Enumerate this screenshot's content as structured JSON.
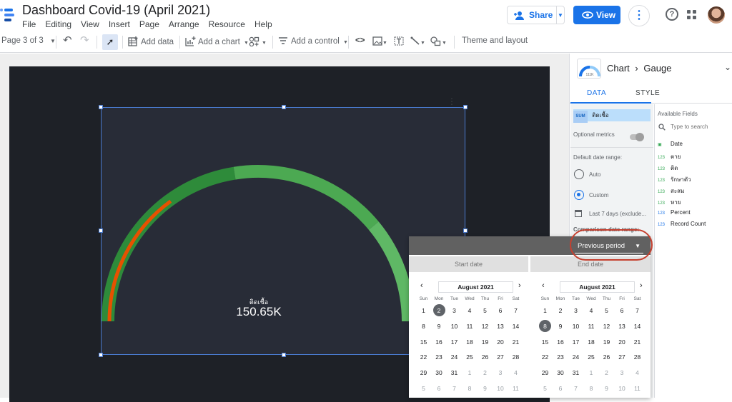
{
  "app": {
    "title": "Dashboard Covid-19 (April 2021)",
    "menu": [
      "File",
      "Editing",
      "View",
      "Insert",
      "Page",
      "Arrange",
      "Resource",
      "Help"
    ],
    "share_label": "Share",
    "view_label": "View",
    "brand_color": "#1a73e8"
  },
  "toolbar": {
    "page_indicator": "Page 3 of 3",
    "add_data": "Add data",
    "add_chart": "Add a chart",
    "add_control": "Add a control",
    "theme_layout": "Theme and layout",
    "code_glyph": "<>"
  },
  "gauge": {
    "metric_label": "ติดเชื้อ",
    "value": "150.65K",
    "fill_fraction": 0.3,
    "track_color": "#4caf50",
    "progress_color": "#e65100"
  },
  "panel": {
    "crumb_parent": "Chart",
    "crumb_child": "Gauge",
    "thumb_value": "111K",
    "tabs": [
      "DATA",
      "STYLE"
    ],
    "metric_agg": "SUM",
    "metric_name": "ติดเชื้อ",
    "optional_metrics": "Optional metrics",
    "default_date_range": "Default date range:",
    "range_auto": "Auto",
    "range_custom": "Custom",
    "range_value": "Last 7 days (exclude...",
    "comparison_label": "Comparison date range:",
    "available_fields": "Available Fields",
    "search_placeholder": "Type to search",
    "fields": [
      {
        "type": "date",
        "name": "Date"
      },
      {
        "type": "123",
        "name": "ตาย"
      },
      {
        "type": "123",
        "name": "ติด"
      },
      {
        "type": "123",
        "name": "รักษาตัว"
      },
      {
        "type": "123",
        "name": "สะสม"
      },
      {
        "type": "123",
        "name": "หาย"
      },
      {
        "type": "123",
        "name": "Percent"
      },
      {
        "type": "123",
        "name": "Record Count"
      }
    ]
  },
  "datepicker": {
    "period": "Previous period",
    "start_label": "Start date",
    "end_label": "End date",
    "month": "August 2021",
    "weekdays": [
      "Sun",
      "Mon",
      "Tue",
      "Wed",
      "Thu",
      "Fri",
      "Sat"
    ],
    "weeks": [
      [
        "1",
        "2",
        "3",
        "4",
        "5",
        "6",
        "7"
      ],
      [
        "8",
        "9",
        "10",
        "11",
        "12",
        "13",
        "14"
      ],
      [
        "15",
        "16",
        "17",
        "18",
        "19",
        "20",
        "21"
      ],
      [
        "22",
        "23",
        "24",
        "25",
        "26",
        "27",
        "28"
      ],
      [
        "29",
        "30",
        "31",
        "1",
        "2",
        "3",
        "4"
      ],
      [
        "5",
        "6",
        "7",
        "8",
        "9",
        "10",
        "11"
      ]
    ],
    "start_selected": "2",
    "end_selected": "8"
  }
}
